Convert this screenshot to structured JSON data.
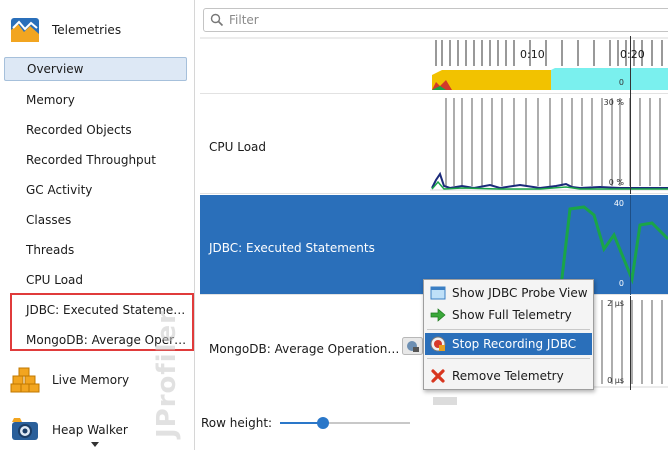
{
  "sidebar": {
    "telemetries_title": "Telemetries",
    "items": [
      {
        "label": "Overview",
        "selected": true
      },
      {
        "label": "Memory"
      },
      {
        "label": "Recorded Objects"
      },
      {
        "label": "Recorded Throughput"
      },
      {
        "label": "GC Activity"
      },
      {
        "label": "Classes"
      },
      {
        "label": "Threads"
      },
      {
        "label": "CPU Load"
      },
      {
        "label": "JDBC: Executed Statements"
      },
      {
        "label": "MongoDB: Average Operation Execution Time"
      }
    ],
    "live_memory_title": "Live Memory",
    "heap_walker_title": "Heap Walker",
    "watermark": "JProfiler"
  },
  "filter": {
    "placeholder": "Filter"
  },
  "timeline": {
    "tick_1": "0:10",
    "tick_2": "0:20"
  },
  "rows": {
    "overview": {
      "scale_min": "0"
    },
    "cpu": {
      "title": "CPU Load",
      "scale_max": "30 %",
      "scale_min": "0 %"
    },
    "jdbc": {
      "title": "JDBC: Executed Statements",
      "scale_max": "40",
      "scale_min": "0"
    },
    "mongo": {
      "title": "MongoDB: Average Operation Execution Time",
      "scale_max": "2 µs",
      "scale_min": "0 µs"
    }
  },
  "context_menu": {
    "items": [
      {
        "label": "Show JDBC Probe View",
        "icon": "probe-view-icon"
      },
      {
        "label": "Show Full Telemetry",
        "icon": "green-arrow-icon"
      },
      {
        "label": "Stop Recording JDBC",
        "icon": "stop-recording-icon",
        "active": true
      },
      {
        "label": "Remove Telemetry",
        "icon": "red-x-icon"
      }
    ]
  },
  "row_height": {
    "label": "Row height:",
    "value_fraction": 0.32
  },
  "colors": {
    "selection_blue": "#2a6fba",
    "highlight_red": "#e03b3b",
    "cpu_line": "#1b2a7a",
    "jdbc_line": "#1aa548",
    "overview_yellow": "#f2c200",
    "overview_cyan": "#7af0ee"
  }
}
